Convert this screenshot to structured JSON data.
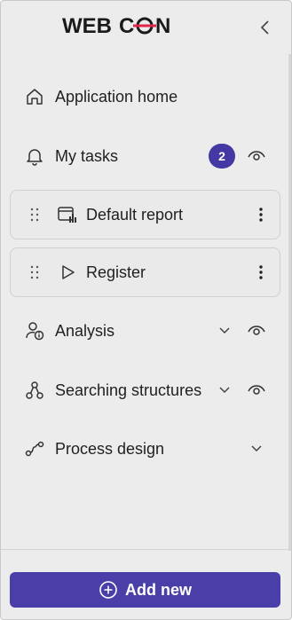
{
  "header": {
    "logo_text": "WEBCON",
    "collapse_icon": "chevron-left-icon"
  },
  "nav": {
    "application_home": {
      "label": "Application home",
      "icon": "home-icon"
    },
    "my_tasks": {
      "label": "My tasks",
      "icon": "bell-icon",
      "badge": "2"
    },
    "default_report": {
      "label": "Default report",
      "icon": "report-icon"
    },
    "register": {
      "label": "Register",
      "icon": "play-icon"
    },
    "analysis": {
      "label": "Analysis",
      "icon": "person-info-icon"
    },
    "searching_structures": {
      "label": "Searching structures",
      "icon": "org-structure-icon"
    },
    "process_design": {
      "label": "Process design",
      "icon": "process-flow-icon"
    }
  },
  "footer": {
    "add_new_label": "Add new",
    "add_icon": "plus-circle-icon"
  },
  "colors": {
    "accent": "#4a3fa8",
    "badge": "#4438a4",
    "panel_bg": "#ececec"
  }
}
